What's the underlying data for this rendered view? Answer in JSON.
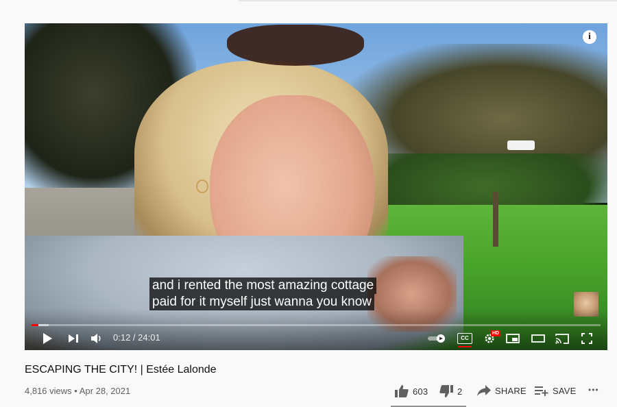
{
  "video": {
    "captions": [
      "and i rented the most amazing cottage",
      "paid for it myself just wanna you know"
    ],
    "time_display": "0:12 / 24:01",
    "progress_fraction": 0.012,
    "buffered_fraction": 0.03,
    "hd_badge": "HD",
    "cc_label": "CC"
  },
  "details": {
    "title": "ESCAPING THE CITY! | Estée Lalonde",
    "views": "4,816 views",
    "separator": "•",
    "date": "Apr 28, 2021"
  },
  "actions": {
    "likes": "603",
    "dislikes": "2",
    "share_label": "SHARE",
    "save_label": "SAVE",
    "more_label": "•••"
  }
}
